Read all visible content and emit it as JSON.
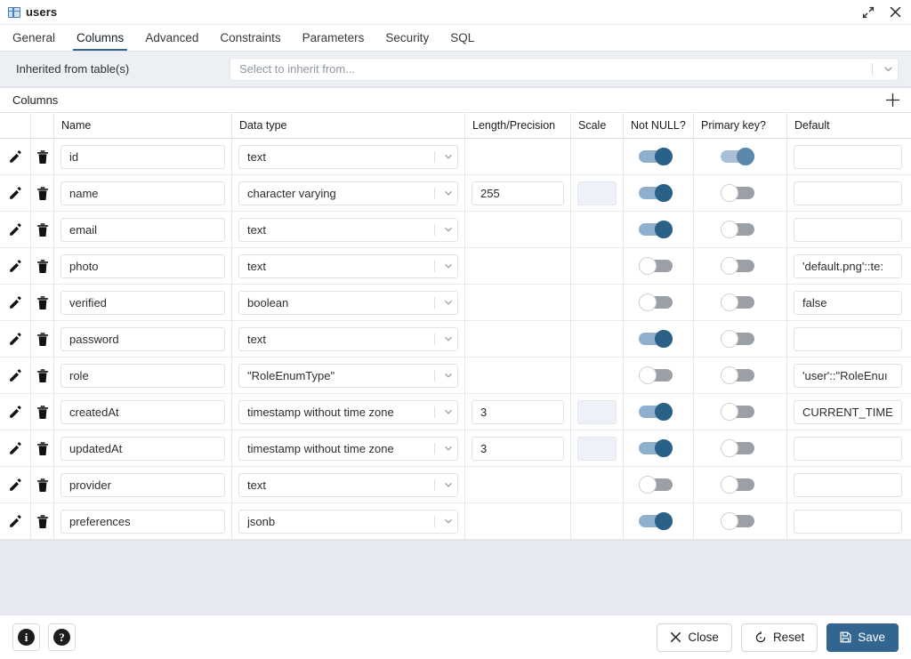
{
  "window": {
    "title": "users",
    "icon": "table-icon",
    "expand_icon": "expand-icon",
    "close_icon": "close-icon"
  },
  "tabs": [
    {
      "label": "General",
      "active": false
    },
    {
      "label": "Columns",
      "active": true
    },
    {
      "label": "Advanced",
      "active": false
    },
    {
      "label": "Constraints",
      "active": false
    },
    {
      "label": "Parameters",
      "active": false
    },
    {
      "label": "Security",
      "active": false
    },
    {
      "label": "SQL",
      "active": false
    }
  ],
  "inherited": {
    "label": "Inherited from table(s)",
    "placeholder": "Select to inherit from...",
    "value": ""
  },
  "columns_panel": {
    "title": "Columns",
    "add_label": "+"
  },
  "grid": {
    "headers": {
      "edit": "",
      "delete": "",
      "name": "Name",
      "datatype": "Data type",
      "length": "Length/Precision",
      "scale": "Scale",
      "notnull": "Not NULL?",
      "primarykey": "Primary key?",
      "default": "Default"
    },
    "rows": [
      {
        "name": "id",
        "datatype": "text",
        "length": "",
        "length_enabled": false,
        "scale": "",
        "scale_enabled": false,
        "not_null": true,
        "primary_key": true,
        "primary_key_muted": true,
        "default": ""
      },
      {
        "name": "name",
        "datatype": "character varying",
        "length": "255",
        "length_enabled": true,
        "scale": "",
        "scale_enabled": true,
        "scale_disabled_style": true,
        "not_null": true,
        "primary_key": false,
        "primary_key_muted": false,
        "default": ""
      },
      {
        "name": "email",
        "datatype": "text",
        "length": "",
        "length_enabled": false,
        "scale": "",
        "scale_enabled": false,
        "not_null": true,
        "primary_key": false,
        "primary_key_muted": false,
        "default": ""
      },
      {
        "name": "photo",
        "datatype": "text",
        "length": "",
        "length_enabled": false,
        "scale": "",
        "scale_enabled": false,
        "not_null": false,
        "primary_key": false,
        "primary_key_muted": false,
        "default": "'default.png'::te:"
      },
      {
        "name": "verified",
        "datatype": "boolean",
        "length": "",
        "length_enabled": false,
        "scale": "",
        "scale_enabled": false,
        "not_null": false,
        "primary_key": false,
        "primary_key_muted": false,
        "default": "false"
      },
      {
        "name": "password",
        "datatype": "text",
        "length": "",
        "length_enabled": false,
        "scale": "",
        "scale_enabled": false,
        "not_null": true,
        "primary_key": false,
        "primary_key_muted": false,
        "default": ""
      },
      {
        "name": "role",
        "datatype": "\"RoleEnumType\"",
        "length": "",
        "length_enabled": false,
        "scale": "",
        "scale_enabled": false,
        "not_null": false,
        "primary_key": false,
        "primary_key_muted": false,
        "default": "'user'::\"RoleEnuı"
      },
      {
        "name": "createdAt",
        "datatype": "timestamp without time zone",
        "length": "3",
        "length_enabled": true,
        "scale": "",
        "scale_enabled": true,
        "scale_disabled_style": true,
        "not_null": true,
        "primary_key": false,
        "primary_key_muted": false,
        "default": "CURRENT_TIME"
      },
      {
        "name": "updatedAt",
        "datatype": "timestamp without time zone",
        "length": "3",
        "length_enabled": true,
        "scale": "",
        "scale_enabled": true,
        "scale_disabled_style": true,
        "not_null": true,
        "primary_key": false,
        "primary_key_muted": false,
        "default": ""
      },
      {
        "name": "provider",
        "datatype": "text",
        "length": "",
        "length_enabled": false,
        "scale": "",
        "scale_enabled": false,
        "not_null": false,
        "primary_key": false,
        "primary_key_muted": false,
        "default": ""
      },
      {
        "name": "preferences",
        "datatype": "jsonb",
        "length": "",
        "length_enabled": false,
        "scale": "",
        "scale_enabled": false,
        "not_null": true,
        "primary_key": false,
        "primary_key_muted": false,
        "default": ""
      }
    ]
  },
  "footer": {
    "info_label": "i",
    "help_label": "?",
    "close_label": "Close",
    "reset_label": "Reset",
    "save_label": "Save"
  },
  "theme": {
    "accent": "#326690",
    "toggle_on_track": "#8eb0ce",
    "toggle_on_knob": "#2a6187",
    "toggle_off": "#9ba0a6",
    "panel_bg": "#e7ebf1",
    "header_bg": "#ecf0f5"
  }
}
